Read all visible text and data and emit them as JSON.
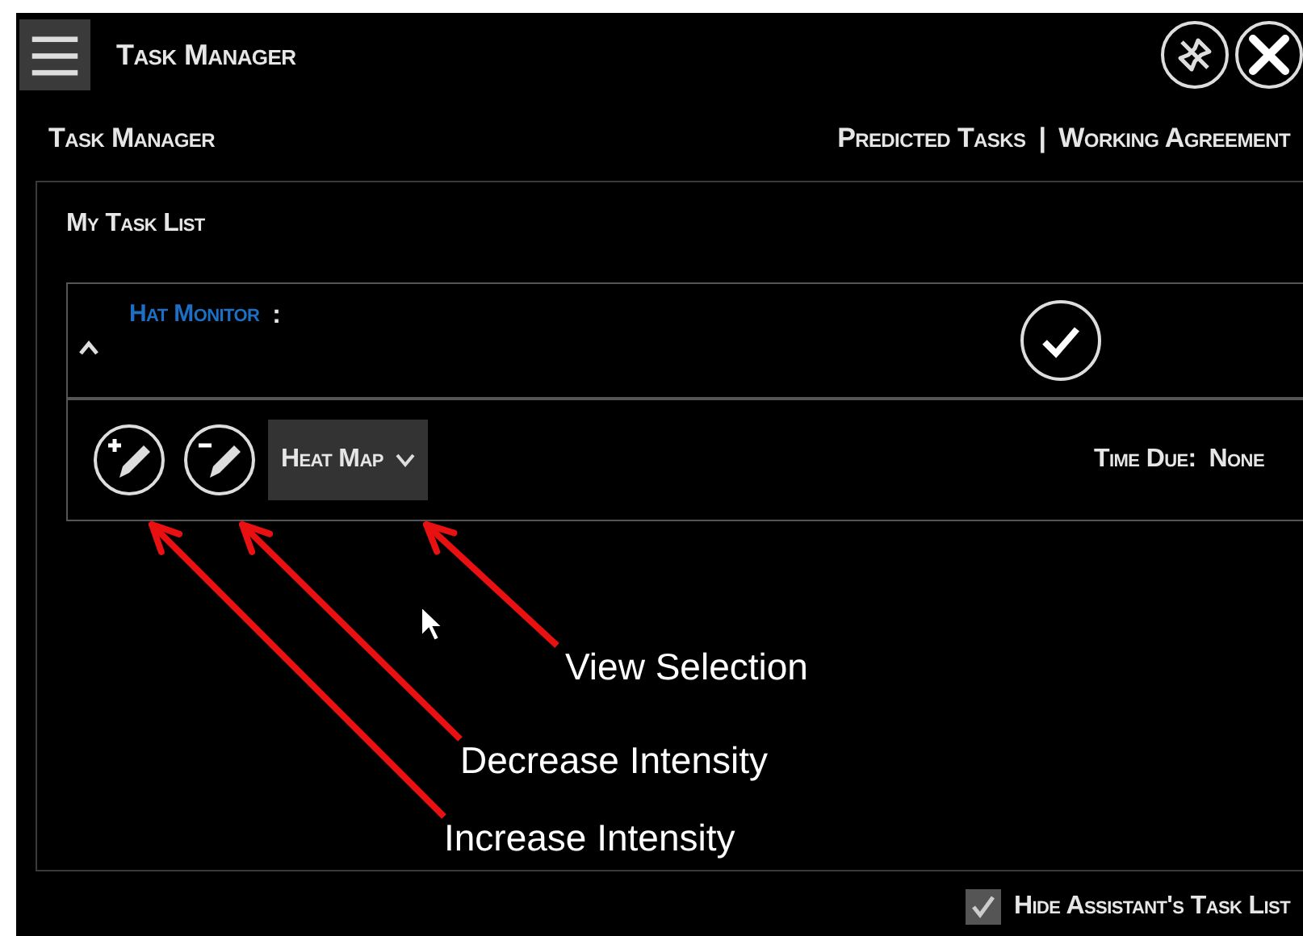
{
  "window": {
    "title": "Task Manager"
  },
  "header": {
    "title": "Task Manager",
    "links": [
      "Predicted Tasks",
      "Working Agreement"
    ],
    "separator": "|"
  },
  "task_list": {
    "title": "My Task List",
    "tasks": [
      {
        "name": "Hat Monitor",
        "separator": ":",
        "expanded": true,
        "view": "Heat Map",
        "time_due_label": "Time Due:",
        "time_due": "None"
      }
    ]
  },
  "annotations": [
    {
      "text": "View Selection"
    },
    {
      "text": "Decrease Intensity"
    },
    {
      "text": "Increase Intensity"
    }
  ],
  "footer": {
    "label": "Hide Assistant's Task List",
    "checked": true
  }
}
